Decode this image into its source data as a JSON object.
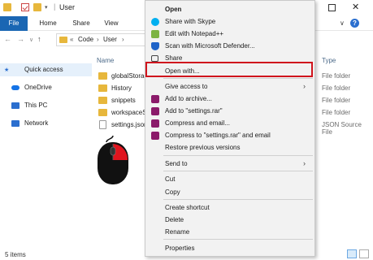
{
  "window": {
    "title": "User"
  },
  "ribbon": {
    "file": "File",
    "home": "Home",
    "share": "Share",
    "view": "View",
    "help_label": "?"
  },
  "address": {
    "back": "←",
    "forward": "→",
    "history": "∨",
    "up": "↑",
    "crumbs": [
      "«",
      "Code",
      "›",
      "User",
      "›"
    ]
  },
  "sidebar": {
    "items": [
      {
        "label": "Quick access",
        "icon": "star-icon",
        "color": "#2b6fcf"
      },
      {
        "label": "OneDrive",
        "icon": "cloud-icon",
        "color": "#1473e6"
      },
      {
        "label": "This PC",
        "icon": "monitor-icon",
        "color": "#2b6fcf"
      },
      {
        "label": "Network",
        "icon": "network-icon",
        "color": "#2b6fcf"
      }
    ]
  },
  "list": {
    "columns": {
      "name": "Name",
      "type": "Type"
    },
    "rows": [
      {
        "name": "globalStorag",
        "type": "File folder",
        "icon": "folder-icon"
      },
      {
        "name": "History",
        "type": "File folder",
        "icon": "folder-icon"
      },
      {
        "name": "snippets",
        "type": "File folder",
        "icon": "folder-icon"
      },
      {
        "name": "workspaceSt",
        "type": "File folder",
        "icon": "folder-icon"
      },
      {
        "name": "settings.json",
        "type": "JSON Source File",
        "icon": "document-icon"
      }
    ]
  },
  "status": {
    "items": "5 items"
  },
  "context_menu": {
    "items": [
      {
        "label": "Open",
        "bold": true,
        "icon": ""
      },
      {
        "label": "Share with Skype",
        "icon": "skype-icon",
        "color": "#00aff0"
      },
      {
        "label": "Edit with Notepad++",
        "icon": "notepadpp-icon",
        "color": "#7cb342"
      },
      {
        "label": "Scan with Microsoft Defender...",
        "icon": "defender-icon",
        "color": "#1e63c8"
      },
      {
        "label": "Share",
        "icon": "share-icon",
        "color": "#444444"
      },
      {
        "label": "Open with...",
        "icon": ""
      },
      {
        "label": "Give access to",
        "icon": "",
        "submenu": true
      },
      {
        "label": "Add to archive...",
        "icon": "winrar-icon",
        "color": "#8b1a6a"
      },
      {
        "label": "Add to \"settings.rar\"",
        "icon": "winrar-icon",
        "color": "#8b1a6a"
      },
      {
        "label": "Compress and email...",
        "icon": "winrar-icon",
        "color": "#8b1a6a"
      },
      {
        "label": "Compress to \"settings.rar\" and email",
        "icon": "winrar-icon",
        "color": "#8b1a6a"
      },
      {
        "label": "Restore previous versions",
        "icon": ""
      },
      {
        "label": "Send to",
        "icon": "",
        "submenu": true
      },
      {
        "label": "Cut",
        "icon": ""
      },
      {
        "label": "Copy",
        "icon": ""
      },
      {
        "label": "Create shortcut",
        "icon": ""
      },
      {
        "label": "Delete",
        "icon": ""
      },
      {
        "label": "Rename",
        "icon": ""
      },
      {
        "label": "Properties",
        "icon": ""
      }
    ],
    "highlight_color": "#d0141d"
  },
  "mouse_indicator": {
    "button": "right-click",
    "accent": "#e0141e"
  }
}
